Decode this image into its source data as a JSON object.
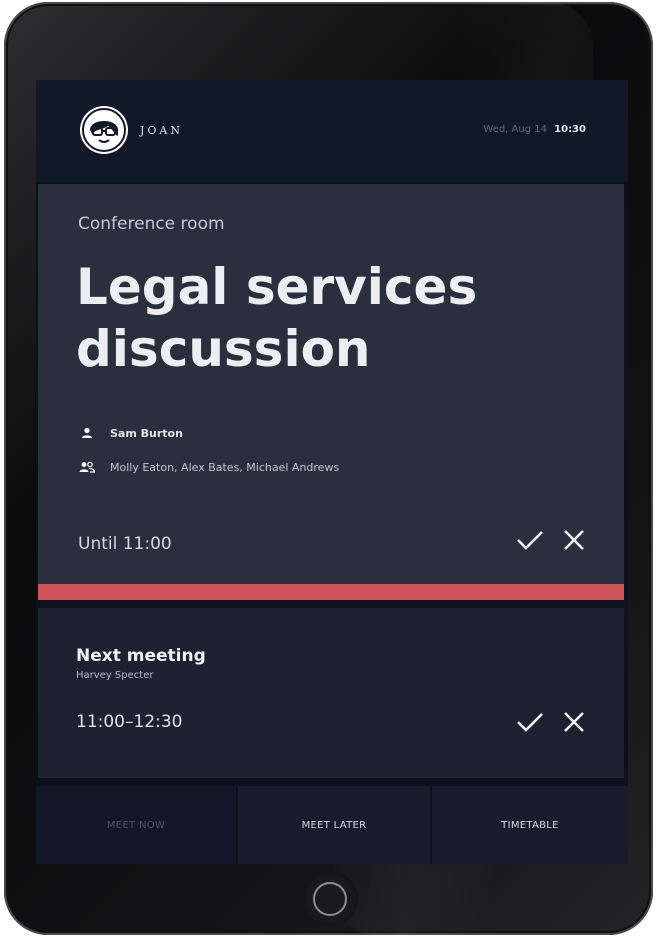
{
  "header": {
    "brand": "JOAN",
    "date": "Wed, Aug 14",
    "time": "10:30"
  },
  "current_meeting": {
    "room": "Conference room",
    "title": "Legal services discussion",
    "organizer": "Sam Burton",
    "attendees": "Molly Eaton, Alex Bates, Michael Andrews",
    "until": "Until 11:00",
    "status_color": "#d0535a"
  },
  "next_meeting": {
    "label": "Next meeting",
    "host": "Harvey Specter",
    "time": "11:00–12:30"
  },
  "nav": {
    "meet_now": "MEET NOW",
    "meet_later": "MEET LATER",
    "timetable": "TIMETABLE"
  },
  "icons": {
    "logo": "joan-avatar-logo-icon",
    "organizer": "person-icon",
    "attendees": "group-icon",
    "confirm": "check-icon",
    "cancel": "close-icon",
    "home": "home-button"
  },
  "colors": {
    "screen_bg": "#0c111b",
    "card_bg": "#2a2e3d",
    "next_bg": "#1d2130",
    "accent_red": "#d0535a"
  }
}
